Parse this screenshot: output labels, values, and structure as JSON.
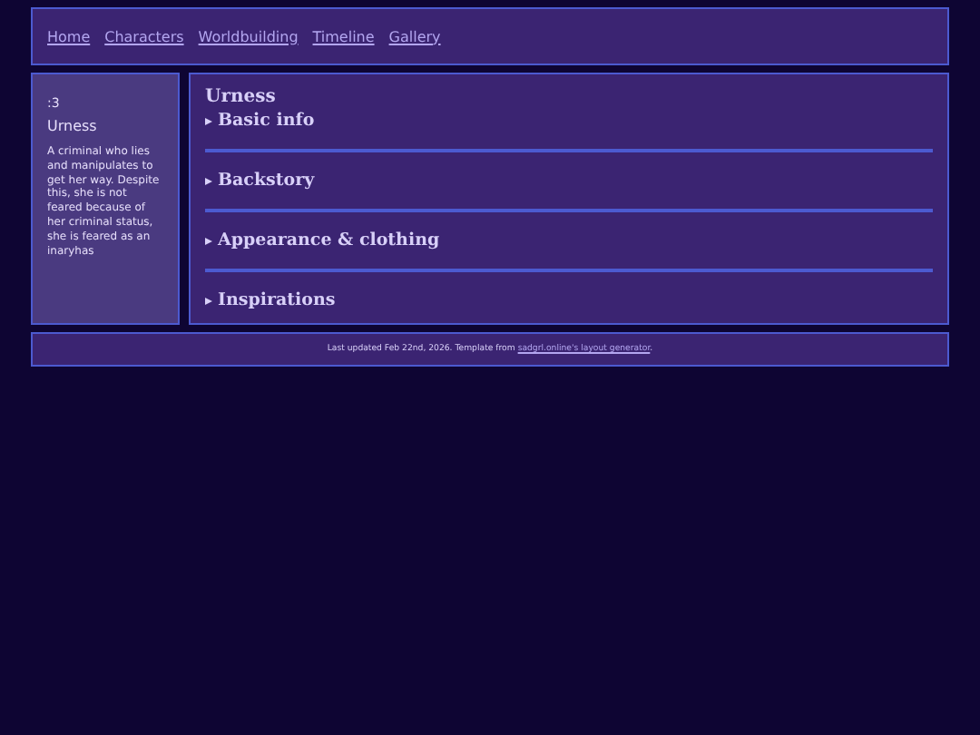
{
  "nav": [
    {
      "label": "Home"
    },
    {
      "label": "Characters"
    },
    {
      "label": "Worldbuilding"
    },
    {
      "label": "Timeline"
    },
    {
      "label": "Gallery"
    }
  ],
  "sidebar": {
    "emote": ":3",
    "name": "Urness",
    "description": "A criminal who lies and manipulates to get her way. Despite this, she is not feared because of her criminal status, she is feared as an inaryhas"
  },
  "main": {
    "title": "Urness",
    "sections": [
      {
        "label": "Basic info",
        "expanded": false
      },
      {
        "label": "Backstory",
        "expanded": false
      },
      {
        "label": "Appearance & clothing",
        "expanded": false
      },
      {
        "label": "Inspirations",
        "expanded": false
      }
    ]
  },
  "footer": {
    "text": "Last updated Feb 22nd, 2026. Template from ",
    "link": "sadgrl.online's layout generator",
    "end": "."
  }
}
